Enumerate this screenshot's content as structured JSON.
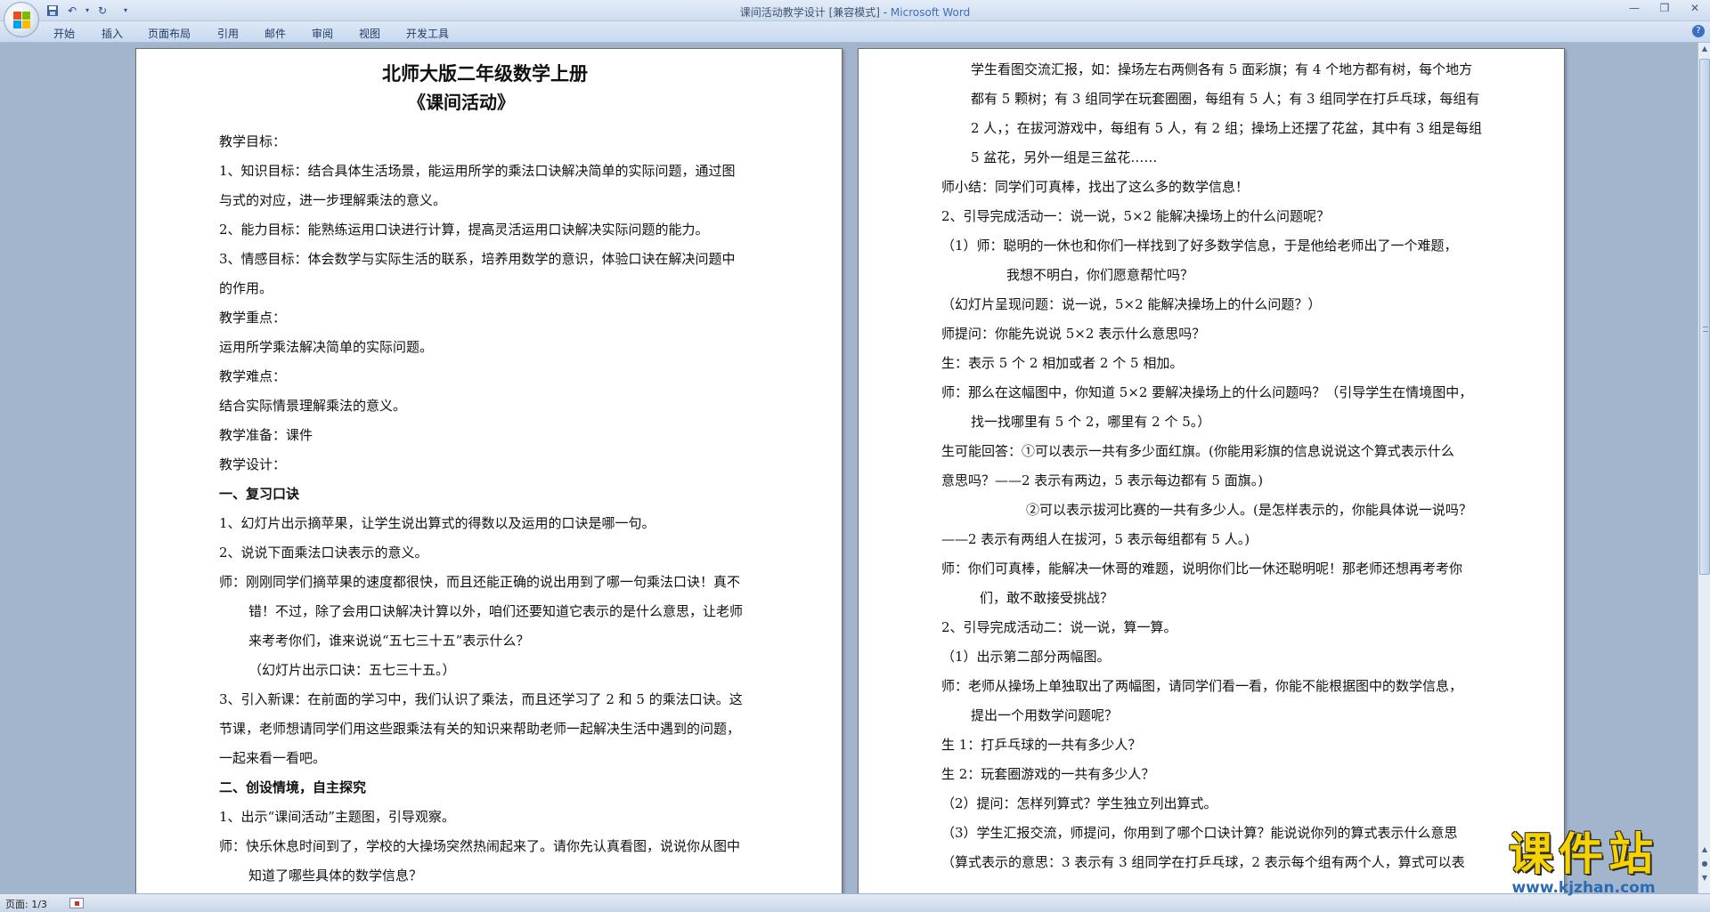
{
  "window": {
    "title": "课间活动教学设计 [兼容模式] - ",
    "app_name": "Microsoft Word"
  },
  "menu": {
    "tabs": [
      "开始",
      "插入",
      "页面布局",
      "引用",
      "邮件",
      "审阅",
      "视图",
      "开发工具"
    ]
  },
  "left_page": {
    "lines": [
      "北师大版二年级数学上册",
      "《课间活动》",
      "教学目标：",
      "1、知识目标：结合具体生活场景，能运用所学的乘法口诀解决简单的实际问题，通过图",
      "与式的对应，进一步理解乘法的意义。",
      "2、能力目标：能熟练运用口诀进行计算，提高灵活运用口诀解决实际问题的能力。",
      "3、情感目标：体会数学与实际生活的联系，培养用数学的意识，体验口诀在解决问题中",
      "的作用。",
      "教学重点：",
      "运用所学乘法解决简单的实际问题。",
      "教学难点：",
      "结合实际情景理解乘法的意义。",
      "教学准备：课件",
      "教学设计：",
      "一、复习口诀",
      "1、幻灯片出示摘苹果，让学生说出算式的得数以及运用的口诀是哪一句。",
      "2、说说下面乘法口诀表示的意义。",
      "师：刚刚同学们摘苹果的速度都很快，而且还能正确的说出用到了哪一句乘法口诀！真不",
      "错！不过，除了会用口诀解决计算以外，咱们还要知道它表示的是什么意思，让老师",
      "来考考你们，谁来说说“五七三十五”表示什么？",
      "（幻灯片出示口诀：五七三十五。）",
      "3、引入新课：在前面的学习中，我们认识了乘法，而且还学习了 2 和 5 的乘法口诀。这",
      "节课，老师想请同学们用这些跟乘法有关的知识来帮助老师一起解决生活中遇到的问题，",
      "一起来看一看吧。",
      "二、创设情境，自主探究",
      "1、出示“课间活动”主题图，引导观察。",
      "师：快乐休息时间到了，学校的大操场突然热闹起来了。请你先认真看图，说说你从图中",
      "知道了哪些具体的数学信息？"
    ]
  },
  "right_page": {
    "lines": [
      "学生看图交流汇报，如：操场左右两侧各有 5 面彩旗；有 4 个地方都有树，每个地方",
      "都有 5 颗树；有 3 组同学在玩套圈圈，每组有 5 人；有 3 组同学在打乒乓球，每组有",
      "2 人，；在拔河游戏中，每组有 5 人，有 2 组；操场上还摆了花盆，其中有 3 组是每组",
      "5 盆花，另外一组是三盆花……",
      "师小结：同学们可真棒，找出了这么多的数学信息！",
      "2、引导完成活动一：说一说，5×2 能解决操场上的什么问题呢？",
      "（1）师：聪明的一休也和你们一样找到了好多数学信息，于是他给老师出了一个难题，",
      "我想不明白，你们愿意帮忙吗？",
      "（幻灯片呈现问题：说一说，5×2 能解决操场上的什么问题？）",
      "师提问：你能先说说 5×2 表示什么意思吗？",
      "生：表示 5 个 2 相加或者 2 个 5 相加。",
      "师：那么在这幅图中，你知道 5×2 要解决操场上的什么问题吗？（引导学生在情境图中，",
      "找一找哪里有 5 个 2，哪里有 2 个 5。）",
      "生可能回答：①可以表示一共有多少面红旗。(你能用彩旗的信息说说这个算式表示什么",
      "意思吗？——2 表示有两边，5 表示每边都有 5 面旗。)",
      "②可以表示拔河比赛的一共有多少人。(是怎样表示的，你能具体说一说吗？",
      "——2 表示有两组人在拔河，5 表示每组都有 5 人。)",
      "师：你们可真棒，能解决一休哥的难题，说明你们比一休还聪明呢！那老师还想再考考你",
      "们，敢不敢接受挑战？",
      "2、引导完成活动二：说一说，算一算。",
      "（1）出示第二部分两幅图。",
      "师：老师从操场上单独取出了两幅图，请同学们看一看，你能不能根据图中的数学信息，",
      "提出一个用数学问题呢？",
      "生 1：打乒乓球的一共有多少人？",
      "生 2：玩套圈游戏的一共有多少人？",
      "（2）提问：怎样列算式？学生独立列出算式。",
      "（3）学生汇报交流，师提问，你用到了哪个口诀计算？能说说你列的算式表示什么意思",
      "（算式表示的意思：3 表示有 3 组同学在打乒乓球，2 表示每个组有两个人，算式可以表"
    ]
  },
  "status": {
    "page_indicator": "页面: 1/3"
  },
  "watermark": {
    "title": "课件站",
    "url": "www.kjzhan.com"
  },
  "colors": {
    "title_app_name": "#3c6fc1",
    "doc_background": "#a3b5cd",
    "watermark_yellow": "#f6d300",
    "watermark_blue": "#2a6bb6"
  }
}
